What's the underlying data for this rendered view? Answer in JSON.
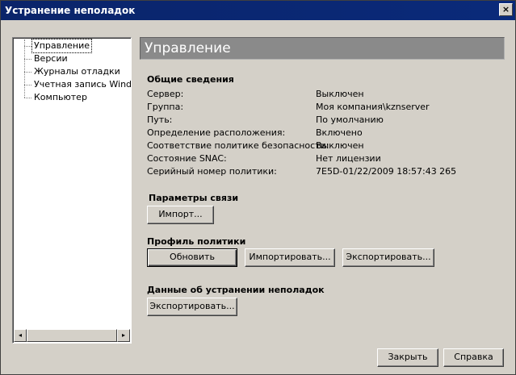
{
  "window": {
    "title": "Устранение неполадок",
    "close_label": "×"
  },
  "tree": {
    "items": [
      {
        "label": "Управление",
        "selected": true
      },
      {
        "label": "Версии"
      },
      {
        "label": "Журналы отладки"
      },
      {
        "label": "Учетная запись Windows"
      },
      {
        "label": "Компьютер"
      }
    ],
    "scroll_left": "◂",
    "scroll_right": "▸"
  },
  "panel": {
    "header": "Управление",
    "general": {
      "title": "Общие сведения",
      "rows": [
        {
          "label": "Сервер:",
          "value": "Выключен"
        },
        {
          "label": "Группа:",
          "value": "Моя компания\\kznserver"
        },
        {
          "label": "Путь:",
          "value": "По умолчанию"
        },
        {
          "label": "Определение расположения:",
          "value": "Включено"
        },
        {
          "label": "Соответствие политике безопасности:",
          "value": "Выключен"
        },
        {
          "label": "Состояние SNAC:",
          "value": "Нет лицензии"
        },
        {
          "label": "Серийный номер политики:",
          "value": "7E5D-01/22/2009 18:57:43 265"
        }
      ]
    },
    "connection": {
      "title": "Параметры связи",
      "import_label": "Импорт..."
    },
    "policy": {
      "title": "Профиль политики",
      "update_label": "Обновить",
      "import_label": "Импортировать...",
      "export_label": "Экспортировать..."
    },
    "troubleshoot": {
      "title": "Данные об устранении неполадок",
      "export_label": "Экспортировать..."
    }
  },
  "footer": {
    "close_label": "Закрыть",
    "help_label": "Справка"
  }
}
